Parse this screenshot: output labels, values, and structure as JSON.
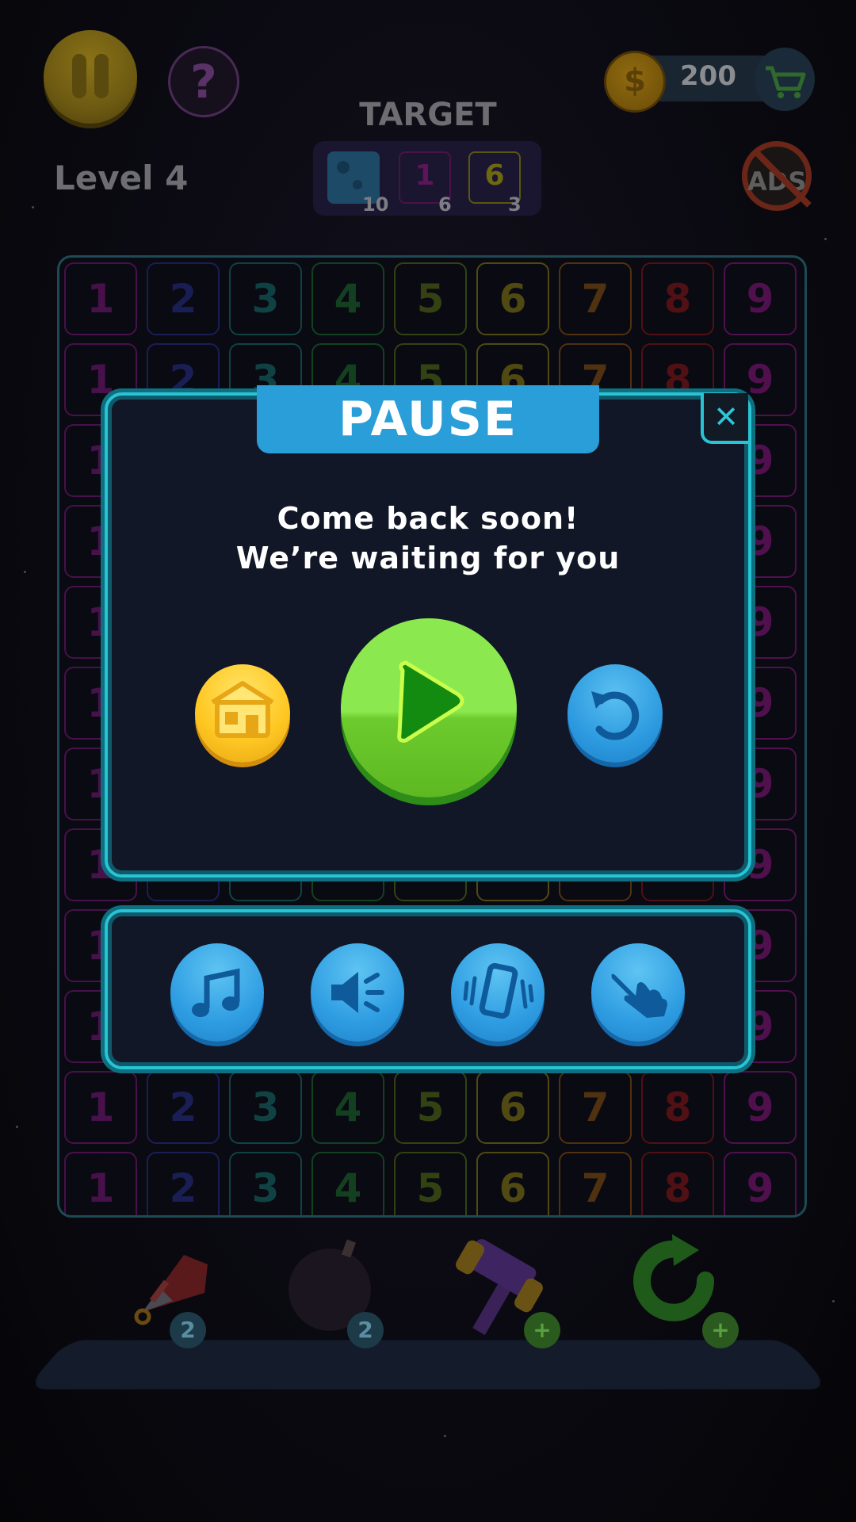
{
  "hud": {
    "coins": "200",
    "coin_symbol": "$",
    "target_title": "TARGET",
    "level": "Level 4",
    "ads_label": "ADS"
  },
  "targets": [
    {
      "kind": "tile-block",
      "label": "",
      "count": "10",
      "color": "#2b7fb0"
    },
    {
      "kind": "number",
      "label": "1",
      "count": "6",
      "color": "#8a1a86"
    },
    {
      "kind": "number",
      "label": "6",
      "count": "3",
      "color": "#8e8a12"
    }
  ],
  "board": {
    "row_digits": [
      "1",
      "2",
      "3",
      "4",
      "5",
      "6",
      "7",
      "8",
      "9"
    ],
    "digit_colors": [
      "#7a177a",
      "#26318a",
      "#15706e",
      "#1c6e2c",
      "#567014",
      "#8a7e12",
      "#8a5210",
      "#8a1616",
      "#8a1680"
    ]
  },
  "pause_dialog": {
    "title": "PAUSE",
    "close_symbol": "✕",
    "message_line1": "Come back soon!",
    "message_line2": "We’re waiting for you"
  },
  "boosters": [
    {
      "name": "rocket",
      "badge": "2"
    },
    {
      "name": "bomb",
      "badge": "2"
    },
    {
      "name": "hammer",
      "badge": "+"
    },
    {
      "name": "shuffle",
      "badge": "+"
    }
  ],
  "settings": [
    {
      "name": "music-icon"
    },
    {
      "name": "sound-icon"
    },
    {
      "name": "vibration-icon"
    },
    {
      "name": "hint-hand-icon"
    }
  ]
}
